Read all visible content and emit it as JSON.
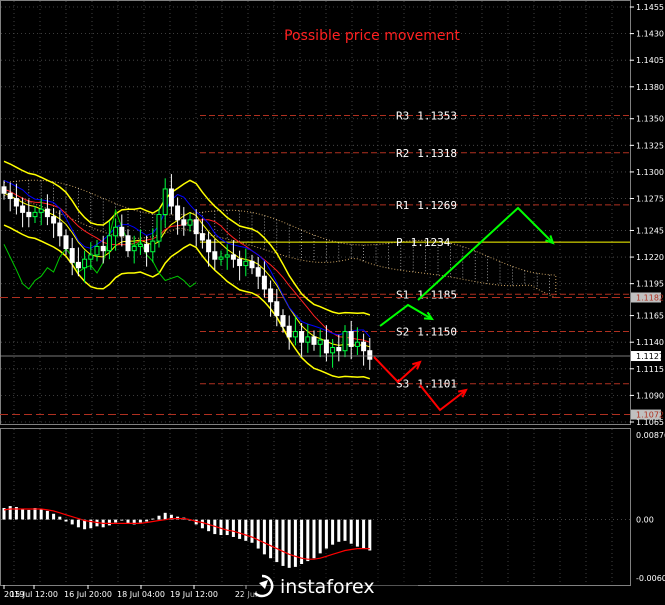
{
  "title": "Possible price movement",
  "watermark": "instaforex",
  "colors": {
    "background": "#000000",
    "candle_up": "#00ff40",
    "candle_down": "#ffffff",
    "bollinger": "#ffff00",
    "kijun": "#ff2020",
    "tenkan": "#0000ff",
    "chikou": "#00cc00",
    "cloud": "#c8a060",
    "pivot_line": "#b03020",
    "pivot_p_line": "#ffff00",
    "arrow_up": "#00ff00",
    "arrow_down": "#ff0000",
    "macd_hist": "#ffffff",
    "macd_signal": "#ff0000",
    "title": "#ff2020"
  },
  "price_axis": {
    "ticks": [
      "1.1455",
      "1.1430",
      "1.1405",
      "1.1380",
      "1.1350",
      "1.1325",
      "1.1300",
      "1.1275",
      "1.1245",
      "1.1220",
      "1.1195",
      "1.1165",
      "1.1140",
      "1.1115",
      "1.1090",
      "1.1065"
    ],
    "current_price": "1.1127",
    "marker_price": "1.1182",
    "marker_price2": "1.1072"
  },
  "indicator_axis": {
    "ticks": [
      "0.00876",
      "0.00",
      "-0.00605"
    ]
  },
  "time_axis": {
    "ticks": [
      "2019",
      "15 Jul 12:00",
      "16 Jul 20:00",
      "18 Jul 04:00",
      "19 Jul 12:00",
      "22 Jul"
    ]
  },
  "chart_data": {
    "type": "candlestick",
    "title": "Possible price movement",
    "y_range": [
      1.106,
      1.146
    ],
    "pivot_levels": [
      {
        "label": "R3",
        "value": "1.1353"
      },
      {
        "label": "R2",
        "value": "1.1318"
      },
      {
        "label": "R1",
        "value": "1.1269"
      },
      {
        "label": "P",
        "value": "1.1234"
      },
      {
        "label": "S1",
        "value": "1.1185"
      },
      {
        "label": "S2",
        "value": "1.1150"
      },
      {
        "label": "S3",
        "value": "1.1101"
      }
    ],
    "candles_close": [
      1.128,
      1.1275,
      1.1268,
      1.1262,
      1.1258,
      1.1262,
      1.1265,
      1.1258,
      1.1252,
      1.124,
      1.1228,
      1.1215,
      1.121,
      1.1218,
      1.1222,
      1.123,
      1.1226,
      1.124,
      1.1248,
      1.124,
      1.1226,
      1.123,
      1.1232,
      1.1225,
      1.1235,
      1.126,
      1.1284,
      1.1268,
      1.1255,
      1.125,
      1.1255,
      1.1242,
      1.1236,
      1.1225,
      1.1218,
      1.122,
      1.1222,
      1.1218,
      1.1212,
      1.1216,
      1.121,
      1.1202,
      1.119,
      1.1178,
      1.1165,
      1.1155,
      1.1145,
      1.115,
      1.114,
      1.1145,
      1.1138,
      1.1142,
      1.113,
      1.1135,
      1.1132,
      1.115,
      1.1136,
      1.114,
      1.1132,
      1.1124
    ],
    "macd_histogram": [
      0.0012,
      0.0014,
      0.0013,
      0.0011,
      0.001,
      0.0012,
      0.0011,
      0.0009,
      0.0006,
      0.0003,
      -0.0002,
      -0.0005,
      -0.0008,
      -0.001,
      -0.0009,
      -0.0007,
      -0.0008,
      -0.0006,
      -0.0003,
      -0.0001,
      -0.0004,
      -0.0005,
      -0.0003,
      -0.0002,
      0.0001,
      0.0004,
      0.0007,
      0.0005,
      0.0003,
      0.0002,
      -0.0001,
      -0.0005,
      -0.0009,
      -0.0012,
      -0.0015,
      -0.0016,
      -0.0016,
      -0.0018,
      -0.002,
      -0.0022,
      -0.0024,
      -0.003,
      -0.0036,
      -0.004,
      -0.0044,
      -0.0048,
      -0.005,
      -0.0049,
      -0.0046,
      -0.0043,
      -0.004,
      -0.0035,
      -0.003,
      -0.0026,
      -0.0023,
      -0.0022,
      -0.0025,
      -0.0028,
      -0.003,
      -0.0032
    ],
    "macd_signal": [
      0.001,
      0.0011,
      0.0011,
      0.0011,
      0.0011,
      0.0011,
      0.0011,
      0.001,
      0.0009,
      0.0007,
      0.0005,
      0.0003,
      0.0001,
      -0.0001,
      -0.0002,
      -0.0003,
      -0.0004,
      -0.0004,
      -0.0004,
      -0.0004,
      -0.0004,
      -0.0004,
      -0.0004,
      -0.0003,
      -0.0002,
      -0.0001,
      0.0,
      0.0001,
      0.0001,
      0.0001,
      0.0,
      -0.0002,
      -0.0003,
      -0.0005,
      -0.0007,
      -0.0009,
      -0.0011,
      -0.0012,
      -0.0014,
      -0.0016,
      -0.0018,
      -0.0021,
      -0.0024,
      -0.0027,
      -0.003,
      -0.0033,
      -0.0036,
      -0.0038,
      -0.004,
      -0.0041,
      -0.0041,
      -0.004,
      -0.0038,
      -0.0036,
      -0.0034,
      -0.0032,
      -0.0031,
      -0.003,
      -0.003,
      -0.003
    ],
    "macd_range": [
      -0.00605,
      0.00876
    ]
  }
}
